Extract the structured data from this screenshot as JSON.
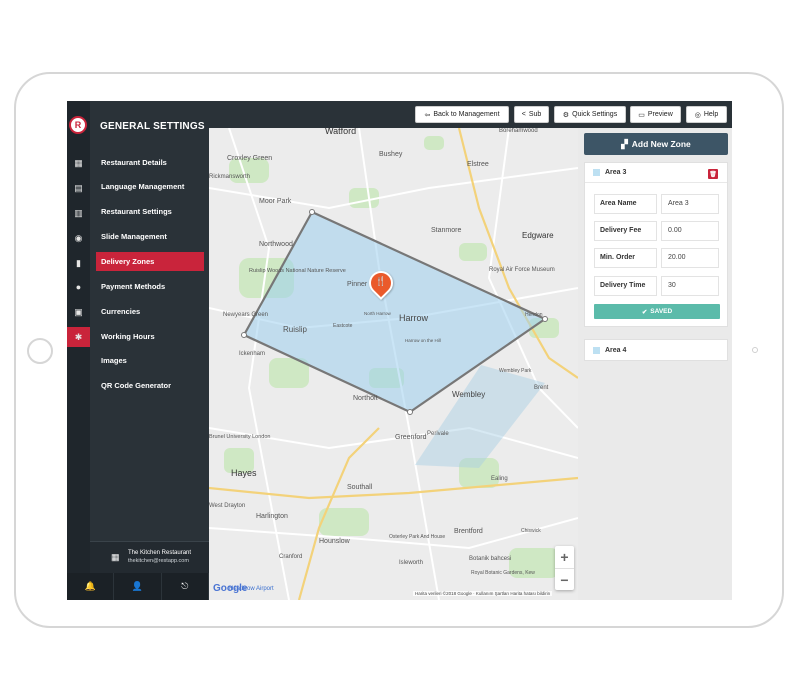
{
  "app": {
    "logo_letter": "R",
    "section_title": "GENERAL SETTINGS"
  },
  "sidebar": {
    "items": [
      {
        "label": "Restaurant Details",
        "icon": "store-icon",
        "glyph": "▦"
      },
      {
        "label": "Language Management",
        "icon": "book-icon",
        "glyph": "▤"
      },
      {
        "label": "Restaurant Settings",
        "icon": "calendar-icon",
        "glyph": "▥"
      },
      {
        "label": "Slide Management",
        "icon": "users-icon",
        "glyph": "◉"
      },
      {
        "label": "Delivery Zones",
        "icon": "chart-icon",
        "glyph": "▮"
      },
      {
        "label": "Payment Methods",
        "icon": "user-icon",
        "glyph": "●"
      },
      {
        "label": "Currencies",
        "icon": "gift-icon",
        "glyph": "▣"
      },
      {
        "label": "Working Hours",
        "icon": "gear-icon",
        "glyph": "✱"
      },
      {
        "label": "Images",
        "icon": "",
        "glyph": ""
      },
      {
        "label": "QR Code Generator",
        "icon": "",
        "glyph": ""
      }
    ],
    "active_index": 4,
    "active_rail_index": 7,
    "footer": {
      "restaurant_name": "The Kitchen Restaurant",
      "email": "thekitchen@restapp.com"
    },
    "bottom_icons": [
      "bell-icon",
      "user-icon",
      "logout-icon"
    ],
    "bottom_glyphs": [
      "🔔",
      "👤",
      "⎋"
    ]
  },
  "topbar": {
    "buttons": [
      {
        "label": "Back to Management",
        "icon": "back-icon",
        "glyph": "⇦"
      },
      {
        "label": "Sub",
        "icon": "share-icon",
        "glyph": "<"
      },
      {
        "label": "Quick Settings",
        "icon": "gear-icon",
        "glyph": "⚙"
      },
      {
        "label": "Preview",
        "icon": "monitor-icon",
        "glyph": "▭"
      },
      {
        "label": "Help",
        "icon": "help-icon",
        "glyph": "◎"
      }
    ]
  },
  "map": {
    "places": [
      "Watford",
      "Borehamwood",
      "Bushey",
      "Croxley Green",
      "Elstree",
      "Moor Park",
      "Rickmansworth",
      "Northwood",
      "Stanmore",
      "Edgware",
      "Ruislip Woods National Nature Reserve",
      "Pinner",
      "Royal Air Force Museum",
      "Harrow",
      "Ruislip",
      "Eastcote",
      "North Harrow",
      "Harrow on the Hill",
      "Newyears Green",
      "Ickenham",
      "Hendon",
      "Wembley",
      "Wembley Park",
      "Brent",
      "Northolt",
      "Greenford",
      "Perivale",
      "Hayes",
      "Southall",
      "Ealing",
      "Brunel University London",
      "West Drayton",
      "Harlington",
      "Hounslow",
      "Osterley Park And House",
      "Brentford",
      "Botanik bahcesi",
      "Royal Botanic Gardens, Kew",
      "Chiswick",
      "Heathrow Airport",
      "Cranford",
      "Isleworth"
    ],
    "zoom_in": "+",
    "zoom_out": "−",
    "attribution": "Google",
    "footer": "Harita verileri ©2018 Google  ·  Kullanım Şartları    Harita hatası bildirin"
  },
  "panel": {
    "add_zone_label": "Add New Zone",
    "add_zone_icon": "map-icon",
    "areas": [
      {
        "name": "Area 3",
        "expanded": true,
        "fields": [
          {
            "label": "Area Name",
            "value": "Area 3"
          },
          {
            "label": "Delivery Fee",
            "value": "0.00"
          },
          {
            "label": "Min. Order",
            "value": "20.00"
          },
          {
            "label": "Delivery Time",
            "value": "30"
          }
        ],
        "saved_label": "SAVED"
      },
      {
        "name": "Area 4",
        "expanded": false
      }
    ]
  },
  "colors": {
    "accent": "#c9243b",
    "sidebar": "#2a3238",
    "zone_fill": "#9fd0ef",
    "saved": "#5bbbaa",
    "add_zone": "#3d5566",
    "pin": "#ea5a2b"
  }
}
